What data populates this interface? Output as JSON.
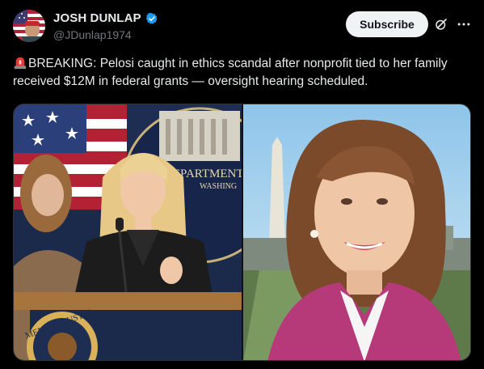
{
  "author": {
    "display_name": "JOSH DUNLAP",
    "handle": "@JDunlap1974",
    "verified": true,
    "avatar_icon": "avatar-flag-photo"
  },
  "actions": {
    "subscribe_label": "Subscribe",
    "grok_icon": "grok-icon",
    "more_icon": "more-horizontal-icon"
  },
  "post": {
    "emoji": "siren-icon",
    "text": "BREAKING: Pelosi caught in ethics scandal after nonprofit tied to her family received $12M in federal grants — oversight hearing scheduled."
  },
  "media": {
    "left_photo": {
      "seal_text": "DEPARTMENT",
      "seal_text_2": "WASHING",
      "podium_seal_text": "MENT OF JUSTIC"
    },
    "right_photo": {}
  },
  "colors": {
    "background": "#000000",
    "text": "#e7e9ea",
    "muted": "#71767b",
    "verified_blue": "#1d9bf0",
    "button_bg": "#eff3f4"
  }
}
